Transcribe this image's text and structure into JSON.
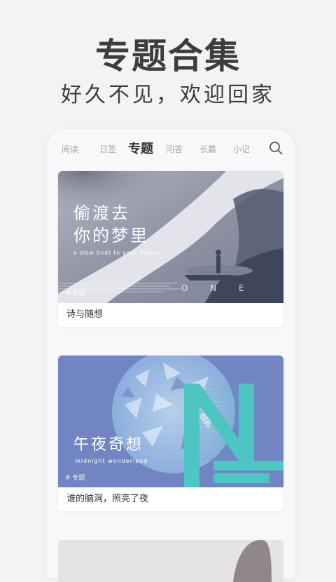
{
  "hero": {
    "title": "专题合集",
    "subtitle": "好久不见，欢迎回家"
  },
  "tabs": [
    {
      "label": "阅读",
      "active": false
    },
    {
      "label": "日签",
      "active": false
    },
    {
      "label": "专题",
      "active": true
    },
    {
      "label": "问答",
      "active": false
    },
    {
      "label": "长篇",
      "active": false
    },
    {
      "label": "小记",
      "active": false
    }
  ],
  "cards": [
    {
      "title_cn_line1": "偷渡去",
      "title_cn_line2": "你的梦里",
      "subtitle_en": "a slow boat to your dream",
      "tag": "# 专题",
      "watermark": "O N E",
      "caption": "诗与随想",
      "colors": {
        "bg": "#9a9dad",
        "accent": "#3e4659"
      }
    },
    {
      "title_cn": "午夜奇想",
      "subtitle_en": "midnight wonderland",
      "tag": "# 专题",
      "caption": "谁的脑洞，照亮了夜",
      "colors": {
        "bg": "#7185c2",
        "accent": "#4ec7c4"
      }
    }
  ],
  "icons": {
    "search": "search-icon"
  }
}
